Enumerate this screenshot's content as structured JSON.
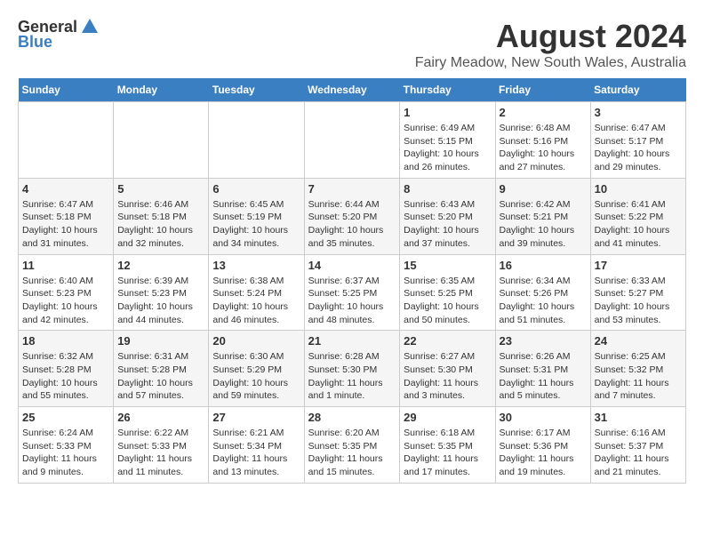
{
  "logo": {
    "general": "General",
    "blue": "Blue"
  },
  "title": {
    "month": "August 2024",
    "location": "Fairy Meadow, New South Wales, Australia"
  },
  "weekdays": [
    "Sunday",
    "Monday",
    "Tuesday",
    "Wednesday",
    "Thursday",
    "Friday",
    "Saturday"
  ],
  "weeks": [
    [
      {
        "day": "",
        "content": ""
      },
      {
        "day": "",
        "content": ""
      },
      {
        "day": "",
        "content": ""
      },
      {
        "day": "",
        "content": ""
      },
      {
        "day": "1",
        "content": "Sunrise: 6:49 AM\nSunset: 5:15 PM\nDaylight: 10 hours\nand 26 minutes."
      },
      {
        "day": "2",
        "content": "Sunrise: 6:48 AM\nSunset: 5:16 PM\nDaylight: 10 hours\nand 27 minutes."
      },
      {
        "day": "3",
        "content": "Sunrise: 6:47 AM\nSunset: 5:17 PM\nDaylight: 10 hours\nand 29 minutes."
      }
    ],
    [
      {
        "day": "4",
        "content": "Sunrise: 6:47 AM\nSunset: 5:18 PM\nDaylight: 10 hours\nand 31 minutes."
      },
      {
        "day": "5",
        "content": "Sunrise: 6:46 AM\nSunset: 5:18 PM\nDaylight: 10 hours\nand 32 minutes."
      },
      {
        "day": "6",
        "content": "Sunrise: 6:45 AM\nSunset: 5:19 PM\nDaylight: 10 hours\nand 34 minutes."
      },
      {
        "day": "7",
        "content": "Sunrise: 6:44 AM\nSunset: 5:20 PM\nDaylight: 10 hours\nand 35 minutes."
      },
      {
        "day": "8",
        "content": "Sunrise: 6:43 AM\nSunset: 5:20 PM\nDaylight: 10 hours\nand 37 minutes."
      },
      {
        "day": "9",
        "content": "Sunrise: 6:42 AM\nSunset: 5:21 PM\nDaylight: 10 hours\nand 39 minutes."
      },
      {
        "day": "10",
        "content": "Sunrise: 6:41 AM\nSunset: 5:22 PM\nDaylight: 10 hours\nand 41 minutes."
      }
    ],
    [
      {
        "day": "11",
        "content": "Sunrise: 6:40 AM\nSunset: 5:23 PM\nDaylight: 10 hours\nand 42 minutes."
      },
      {
        "day": "12",
        "content": "Sunrise: 6:39 AM\nSunset: 5:23 PM\nDaylight: 10 hours\nand 44 minutes."
      },
      {
        "day": "13",
        "content": "Sunrise: 6:38 AM\nSunset: 5:24 PM\nDaylight: 10 hours\nand 46 minutes."
      },
      {
        "day": "14",
        "content": "Sunrise: 6:37 AM\nSunset: 5:25 PM\nDaylight: 10 hours\nand 48 minutes."
      },
      {
        "day": "15",
        "content": "Sunrise: 6:35 AM\nSunset: 5:25 PM\nDaylight: 10 hours\nand 50 minutes."
      },
      {
        "day": "16",
        "content": "Sunrise: 6:34 AM\nSunset: 5:26 PM\nDaylight: 10 hours\nand 51 minutes."
      },
      {
        "day": "17",
        "content": "Sunrise: 6:33 AM\nSunset: 5:27 PM\nDaylight: 10 hours\nand 53 minutes."
      }
    ],
    [
      {
        "day": "18",
        "content": "Sunrise: 6:32 AM\nSunset: 5:28 PM\nDaylight: 10 hours\nand 55 minutes."
      },
      {
        "day": "19",
        "content": "Sunrise: 6:31 AM\nSunset: 5:28 PM\nDaylight: 10 hours\nand 57 minutes."
      },
      {
        "day": "20",
        "content": "Sunrise: 6:30 AM\nSunset: 5:29 PM\nDaylight: 10 hours\nand 59 minutes."
      },
      {
        "day": "21",
        "content": "Sunrise: 6:28 AM\nSunset: 5:30 PM\nDaylight: 11 hours\nand 1 minute."
      },
      {
        "day": "22",
        "content": "Sunrise: 6:27 AM\nSunset: 5:30 PM\nDaylight: 11 hours\nand 3 minutes."
      },
      {
        "day": "23",
        "content": "Sunrise: 6:26 AM\nSunset: 5:31 PM\nDaylight: 11 hours\nand 5 minutes."
      },
      {
        "day": "24",
        "content": "Sunrise: 6:25 AM\nSunset: 5:32 PM\nDaylight: 11 hours\nand 7 minutes."
      }
    ],
    [
      {
        "day": "25",
        "content": "Sunrise: 6:24 AM\nSunset: 5:33 PM\nDaylight: 11 hours\nand 9 minutes."
      },
      {
        "day": "26",
        "content": "Sunrise: 6:22 AM\nSunset: 5:33 PM\nDaylight: 11 hours\nand 11 minutes."
      },
      {
        "day": "27",
        "content": "Sunrise: 6:21 AM\nSunset: 5:34 PM\nDaylight: 11 hours\nand 13 minutes."
      },
      {
        "day": "28",
        "content": "Sunrise: 6:20 AM\nSunset: 5:35 PM\nDaylight: 11 hours\nand 15 minutes."
      },
      {
        "day": "29",
        "content": "Sunrise: 6:18 AM\nSunset: 5:35 PM\nDaylight: 11 hours\nand 17 minutes."
      },
      {
        "day": "30",
        "content": "Sunrise: 6:17 AM\nSunset: 5:36 PM\nDaylight: 11 hours\nand 19 minutes."
      },
      {
        "day": "31",
        "content": "Sunrise: 6:16 AM\nSunset: 5:37 PM\nDaylight: 11 hours\nand 21 minutes."
      }
    ]
  ]
}
